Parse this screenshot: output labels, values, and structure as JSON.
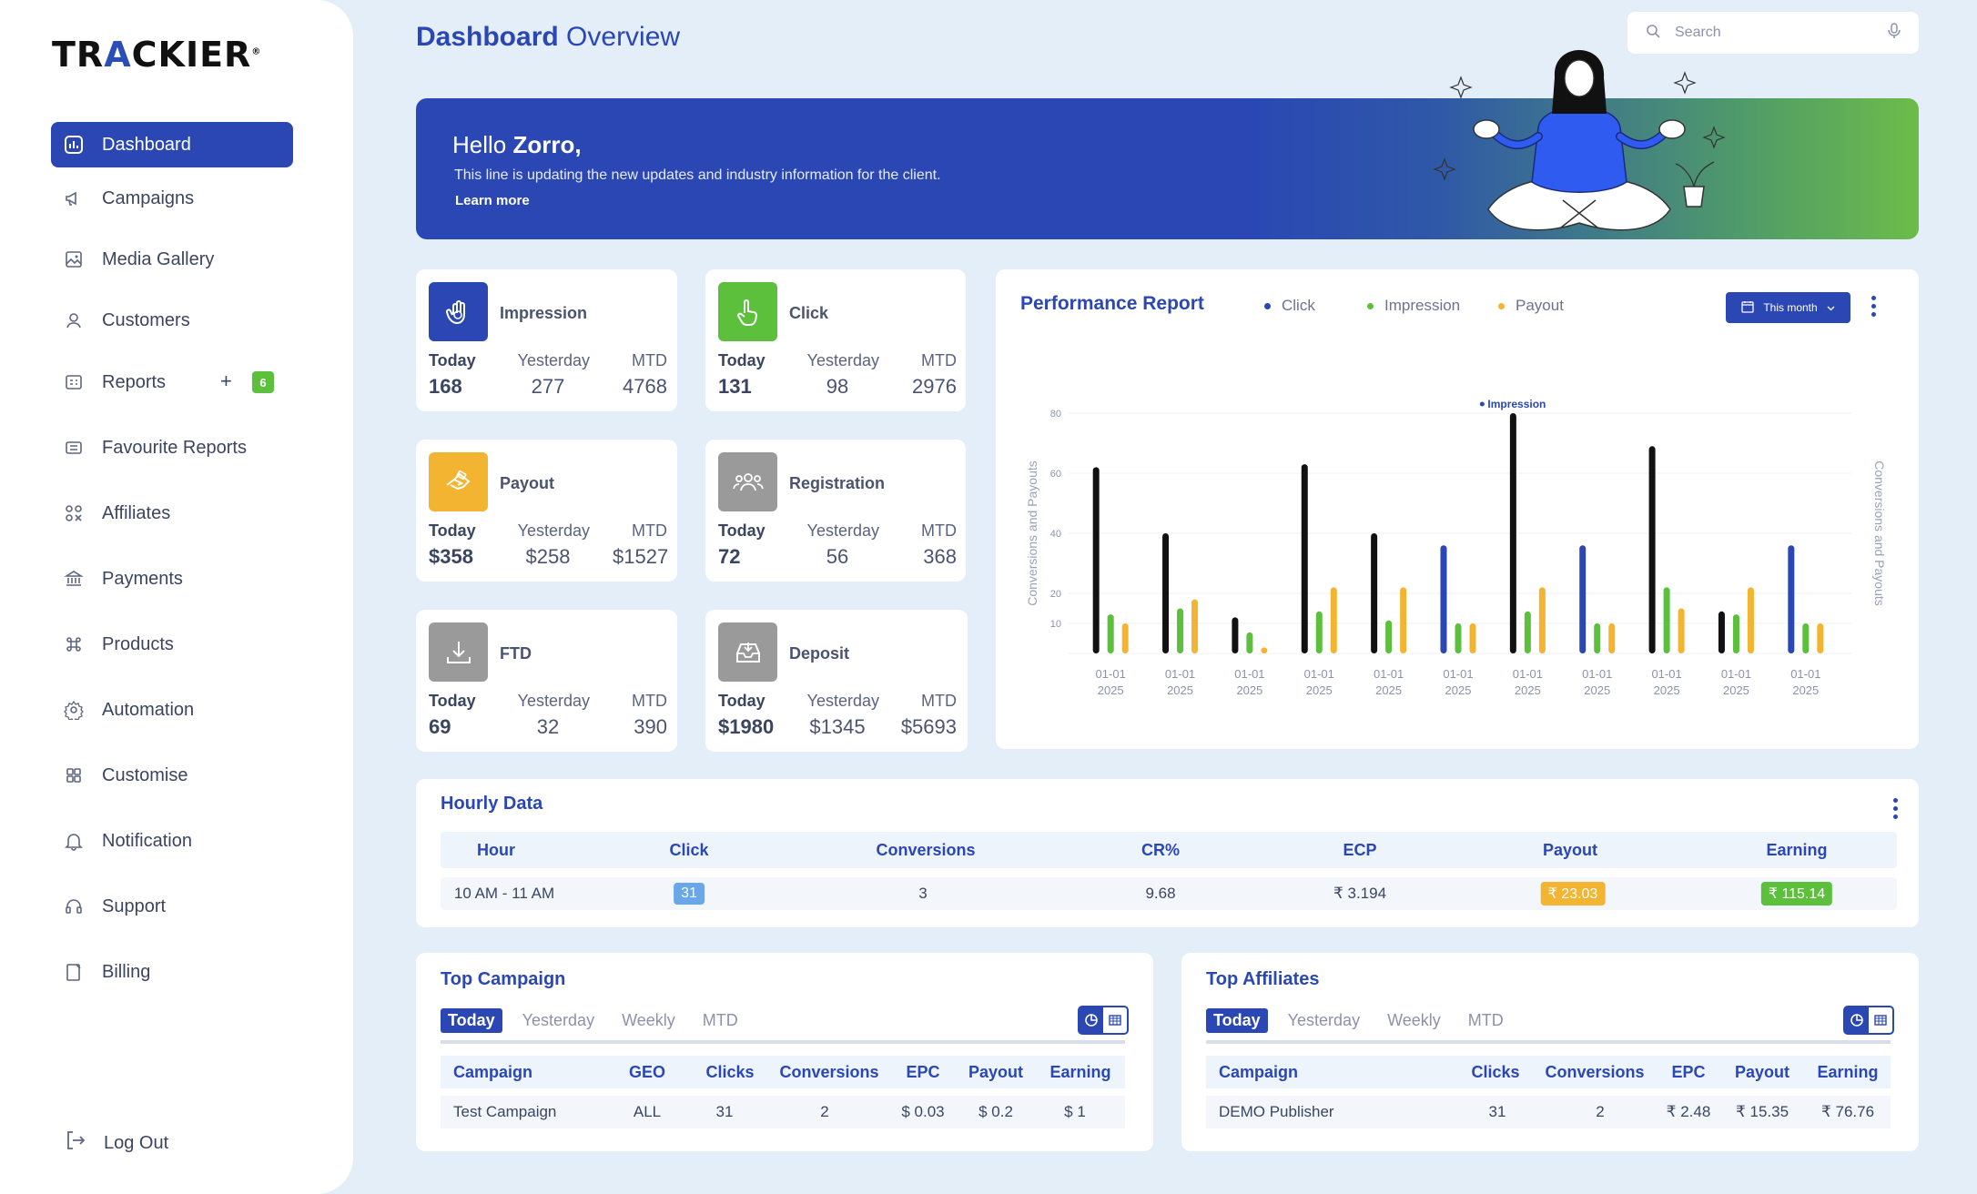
{
  "brand": {
    "logo_text_a": "TR",
    "logo_text_accent": "A",
    "logo_text_b": "CKIER",
    "logo_mark": "®"
  },
  "header": {
    "title_bold": "Dashboard",
    "title_rest": "Overview",
    "search_placeholder": "Search"
  },
  "sidebar": {
    "items": [
      {
        "label": "Dashboard",
        "icon": "chart-box-icon"
      },
      {
        "label": "Campaigns",
        "icon": "megaphone-icon"
      },
      {
        "label": "Media Gallery",
        "icon": "image-icon"
      },
      {
        "label": "Customers",
        "icon": "user-icon"
      },
      {
        "label": "Reports",
        "icon": "report-icon",
        "plus": "+",
        "badge": "6"
      },
      {
        "label": "Favourite Reports",
        "icon": "favourite-report-icon"
      },
      {
        "label": "Affiliates",
        "icon": "affiliates-icon"
      },
      {
        "label": "Payments",
        "icon": "bank-icon"
      },
      {
        "label": "Products",
        "icon": "command-icon"
      },
      {
        "label": "Automation",
        "icon": "cog-icon"
      },
      {
        "label": "Customise",
        "icon": "grid-icon"
      },
      {
        "label": "Notification",
        "icon": "bell-icon"
      },
      {
        "label": "Support",
        "icon": "headset-icon"
      },
      {
        "label": "Billing",
        "icon": "billing-icon"
      }
    ],
    "logout": "Log Out"
  },
  "banner": {
    "greeting": "Hello",
    "name": "Zorro,",
    "line": "This line is updating the new updates and industry information for the client.",
    "learn_more": "Learn more"
  },
  "stat_labels": {
    "today": "Today",
    "yesterday": "Yesterday",
    "mtd": "MTD"
  },
  "stats": [
    {
      "name": "Impression",
      "today": "168",
      "yesterday": "277",
      "mtd": "4768",
      "color": "#2a47b4",
      "icon": "hand-icon"
    },
    {
      "name": "Click",
      "today": "131",
      "yesterday": "98",
      "mtd": "2976",
      "color": "#5cc03c",
      "icon": "pointer-hand-icon"
    },
    {
      "name": "Payout",
      "today": "$358",
      "yesterday": "$258",
      "mtd": "$1527",
      "color": "#f3b431",
      "icon": "payout-hand-icon"
    },
    {
      "name": "Registration",
      "today": "72",
      "yesterday": "56",
      "mtd": "368",
      "color": "#9a9a9a",
      "icon": "group-icon"
    },
    {
      "name": "FTD",
      "today": "69",
      "yesterday": "32",
      "mtd": "390",
      "color": "#9a9a9a",
      "icon": "download-icon"
    },
    {
      "name": "Deposit",
      "today": "$1980",
      "yesterday": "$1345",
      "mtd": "$5693",
      "color": "#9a9a9a",
      "icon": "inbox-icon"
    }
  ],
  "performance": {
    "title": "Performance Report",
    "legend": [
      "Click",
      "Impression",
      "Payout"
    ],
    "period": "This month"
  },
  "chart_data": {
    "type": "bar",
    "categories": [
      "01-01 2025",
      "01-01 2025",
      "01-01 2025",
      "01-01 2025",
      "01-01 2025",
      "01-01 2025",
      "01-01 2025",
      "01-01 2025",
      "01-01 2025",
      "01-01 2025",
      "01-01 2025"
    ],
    "series": [
      {
        "name": "Click",
        "values": [
          62,
          40,
          12,
          63,
          40,
          36,
          80,
          36,
          69,
          14,
          36
        ],
        "colors": [
          "#111111",
          "#111111",
          "#111111",
          "#111111",
          "#111111",
          "#2a47b4",
          "#111111",
          "#2a47b4",
          "#111111",
          "#111111",
          "#2a47b4"
        ]
      },
      {
        "name": "Impression",
        "values": [
          13,
          15,
          7,
          14,
          11,
          10,
          14,
          10,
          22,
          13,
          10
        ],
        "color": "#5cc03c"
      },
      {
        "name": "Payout",
        "values": [
          10,
          18,
          2,
          22,
          22,
          10,
          22,
          10,
          15,
          22,
          10
        ],
        "color": "#f3b431"
      }
    ],
    "ylabel": "Conversions and Payouts",
    "ylabel_right": "Conversions and Payouts",
    "yticks": [
      10,
      20,
      40,
      60,
      80
    ],
    "ylim": [
      0,
      80
    ],
    "annotation": "Impression",
    "grid": true
  },
  "hourly": {
    "title": "Hourly Data",
    "columns": [
      "Hour",
      "Click",
      "Conversions",
      "CR%",
      "ECP",
      "Payout",
      "Earning"
    ],
    "row": {
      "hour": "10 AM - 11 AM",
      "click": "31",
      "conversions": "3",
      "cr": "9.68",
      "ecp": "₹ 3.194",
      "payout": "₹ 23.03",
      "earning": "₹ 115.14"
    }
  },
  "tabs": [
    "Today",
    "Yesterday",
    "Weekly",
    "MTD"
  ],
  "top_campaign": {
    "title": "Top Campaign",
    "columns": [
      "Campaign",
      "GEO",
      "Clicks",
      "Conversions",
      "EPC",
      "Payout",
      "Earning"
    ],
    "row": [
      "Test Campaign",
      "ALL",
      "31",
      "2",
      "$ 0.03",
      "$ 0.2",
      "$ 1"
    ]
  },
  "top_affiliates": {
    "title": "Top Affiliates",
    "columns": [
      "Campaign",
      "Clicks",
      "Conversions",
      "EPC",
      "Payout",
      "Earning"
    ],
    "row": [
      "DEMO Publisher",
      "31",
      "2",
      "₹ 2.48",
      "₹ 15.35",
      "₹ 76.76"
    ]
  }
}
